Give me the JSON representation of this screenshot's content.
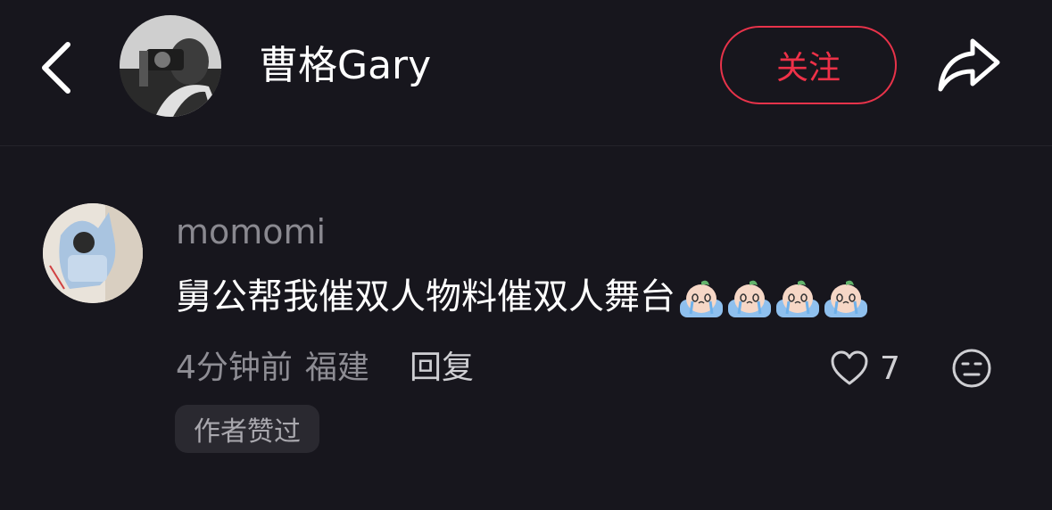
{
  "header": {
    "title": "曹格Gary",
    "follow_label": "关注",
    "back_icon": "chevron-left-icon",
    "share_icon": "share-icon",
    "accent_color": "#ee3148"
  },
  "comment": {
    "username": "momomi",
    "text": "舅公帮我催双人物料催双人舞台",
    "emoji_count": 4,
    "emoji_icon": "crying-peach-emoji-icon",
    "time": "4分钟前",
    "location": "福建",
    "reply_label": "回复",
    "like_count": "7",
    "like_icon": "heart-outline-icon",
    "dislike_icon": "meh-face-icon",
    "badge": "作者赞过"
  }
}
